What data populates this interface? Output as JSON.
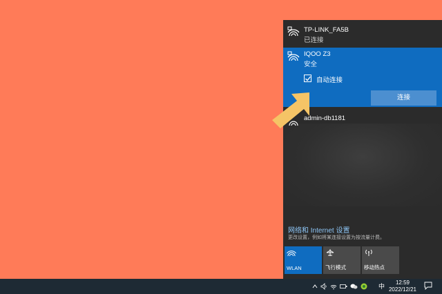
{
  "networks": [
    {
      "name": "TP-LINK_FA5B",
      "status": "已连接"
    },
    {
      "name": "IQOO Z3",
      "status": "安全",
      "auto_connect_label": "自动连接",
      "auto_connect_checked": true,
      "connect_label": "连接"
    },
    {
      "name": "admin-db1181"
    }
  ],
  "settings": {
    "link": "网络和 Internet 设置",
    "description": "更改设置，例如将某连接设置为按流量计费。"
  },
  "quick_actions": [
    {
      "label": "WLAN",
      "icon": "wifi-icon",
      "active": true
    },
    {
      "label": "飞行模式",
      "icon": "airplane-icon",
      "active": false
    },
    {
      "label": "移动热点",
      "icon": "hotspot-icon",
      "active": false
    }
  ],
  "taskbar": {
    "ime": "中",
    "time": "12:59",
    "date": "2022/12/21"
  },
  "colors": {
    "desktop": "#ff7b58",
    "flyout": "#2b2b2b",
    "accent": "#0f6cc0",
    "link": "#8ec6f6",
    "arrow": "#f5c466"
  }
}
